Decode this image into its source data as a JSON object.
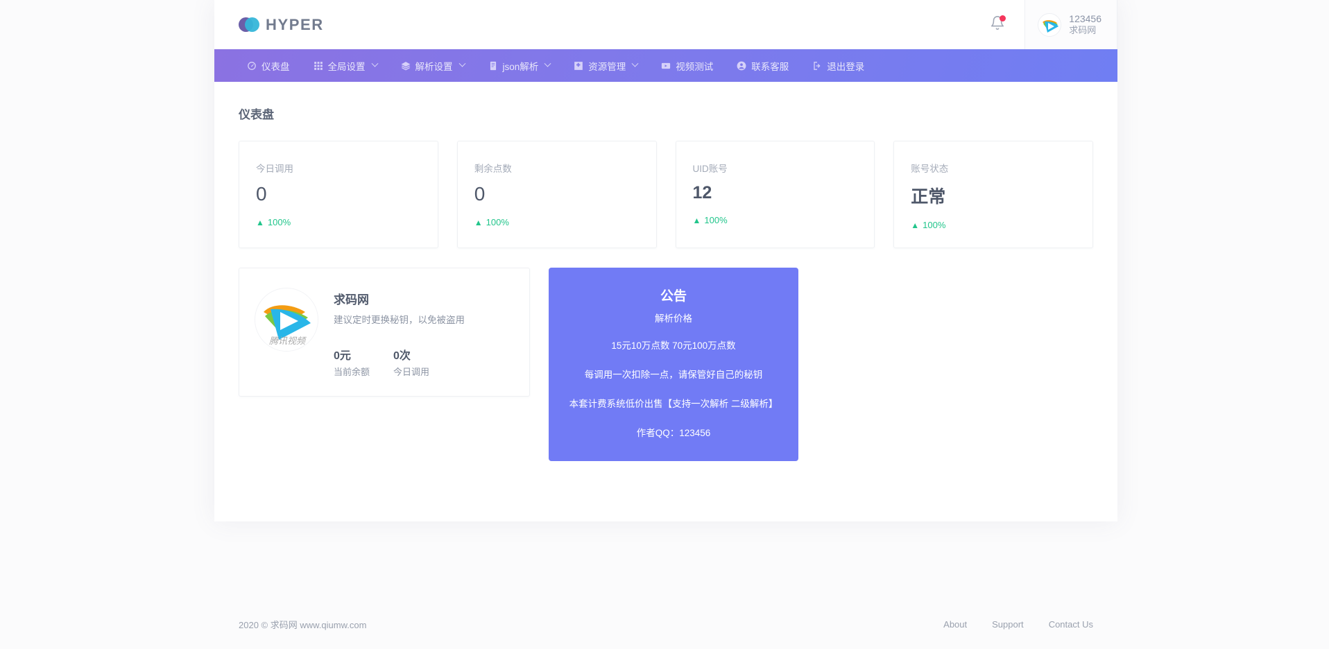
{
  "brand": {
    "name": "HYPER"
  },
  "header": {
    "bell_icon": "bell-icon",
    "user_id": "123456",
    "user_name": "求码网"
  },
  "nav": {
    "items": [
      {
        "label": "仪表盘",
        "icon": "gauge-icon",
        "caret": false
      },
      {
        "label": "全局设置",
        "icon": "grid-icon",
        "caret": true
      },
      {
        "label": "解析设置",
        "icon": "layers-icon",
        "caret": true
      },
      {
        "label": "json解析",
        "icon": "document-icon",
        "caret": true
      },
      {
        "label": "资源管理",
        "icon": "puzzle-icon",
        "caret": true
      },
      {
        "label": "视频测试",
        "icon": "video-icon",
        "caret": false
      },
      {
        "label": "联系客服",
        "icon": "user-circle-icon",
        "caret": false
      },
      {
        "label": "退出登录",
        "icon": "logout-icon",
        "caret": false
      }
    ]
  },
  "main": {
    "page_title": "仪表盘",
    "stats": [
      {
        "label": "今日调用",
        "value": "0",
        "delta": "100%",
        "bold": false
      },
      {
        "label": "剩余点数",
        "value": "0",
        "delta": "100%",
        "bold": false
      },
      {
        "label": "UID账号",
        "value": "12",
        "delta": "100%",
        "bold": true
      },
      {
        "label": "账号状态",
        "value": "正常",
        "delta": "100%",
        "bold": true
      }
    ],
    "profile": {
      "name": "求码网",
      "desc": "建议定时更换秘钥，以免被盗用",
      "stats": [
        {
          "num": "0元",
          "label": "当前余额"
        },
        {
          "num": "0次",
          "label": "今日调用"
        }
      ]
    },
    "notice": {
      "title": "公告",
      "subtitle": "解析价格",
      "lines": [
        "15元10万点数 70元100万点数",
        "每调用一次扣除一点，请保管好自己的秘钥",
        "本套计费系统低价出售【支持一次解析 二级解析】",
        "作者QQ：123456"
      ]
    }
  },
  "footer": {
    "copyright": "2020 © 求码网 www.qiumw.com",
    "links": [
      "About",
      "Support",
      "Contact Us"
    ]
  },
  "colors": {
    "nav_start": "#8b72e2",
    "nav_end": "#707ef3",
    "notice_bg": "#717bf5",
    "delta_green": "#22c58b",
    "badge_red": "#f5365c"
  }
}
